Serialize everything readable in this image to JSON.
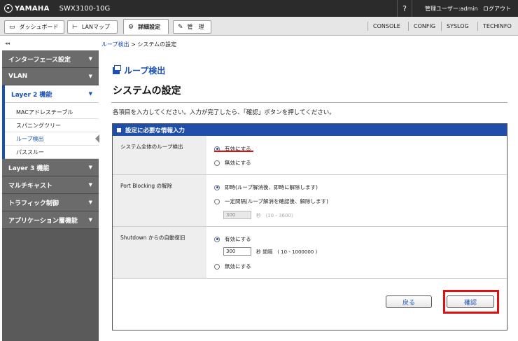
{
  "header": {
    "brand": "YAMAHA",
    "model": "SWX3100-10G",
    "help": "?",
    "user": "管理ユーザー:admin",
    "logout": "ログアウト"
  },
  "tabs": {
    "dashboard": "ダッシュボード",
    "lanmap": "LANマップ",
    "advanced": "詳細設定",
    "admin": "管　理"
  },
  "topnav": [
    "CONSOLE",
    "CONFIG",
    "SYSLOG",
    "TECHINFO"
  ],
  "collapse": "◂◂",
  "breadcrumb": {
    "parent": "ループ検出",
    "sep": " > ",
    "current": "システムの設定"
  },
  "sidebar": {
    "items": [
      {
        "label": "インターフェース設定"
      },
      {
        "label": "VLAN"
      },
      {
        "label": "Layer 2 機能"
      },
      {
        "label": "Layer 3 機能"
      },
      {
        "label": "マルチキャスト"
      },
      {
        "label": "トラフィック制御"
      },
      {
        "label": "アプリケーション層機能"
      }
    ],
    "sub": [
      {
        "label": "MACアドレステーブル"
      },
      {
        "label": "スパニングツリー"
      },
      {
        "label": "ループ検出"
      },
      {
        "label": "パススルー"
      }
    ],
    "arrow": "▼"
  },
  "main": {
    "section_title": "ループ検出",
    "page_title": "システムの設定",
    "instruction": "各項目を入力してください。入力が完了したら、「確認」ボタンを押してください。",
    "form_title": "設定に必要な情報入力",
    "rows": {
      "loop_detect": {
        "label": "システム全体のループ検出",
        "opt_enable": "有効にする",
        "opt_disable": "無効にする"
      },
      "port_blocking": {
        "label": "Port Blocking の解除",
        "opt_immediate": "即時(ループ解消後、即時に解除します)",
        "opt_interval": "一定間隔(ループ解消を確認後、解除します)",
        "interval_value": "300",
        "interval_hint": "秒 （10 - 3600）"
      },
      "shutdown": {
        "label": "Shutdown からの自動復旧",
        "opt_enable": "有効にする",
        "interval_value": "300",
        "interval_hint": "秒 間隔　( 10 - 1000000 )",
        "opt_disable": "無効にする"
      }
    },
    "back_button": "戻る",
    "confirm_button": "確認"
  }
}
